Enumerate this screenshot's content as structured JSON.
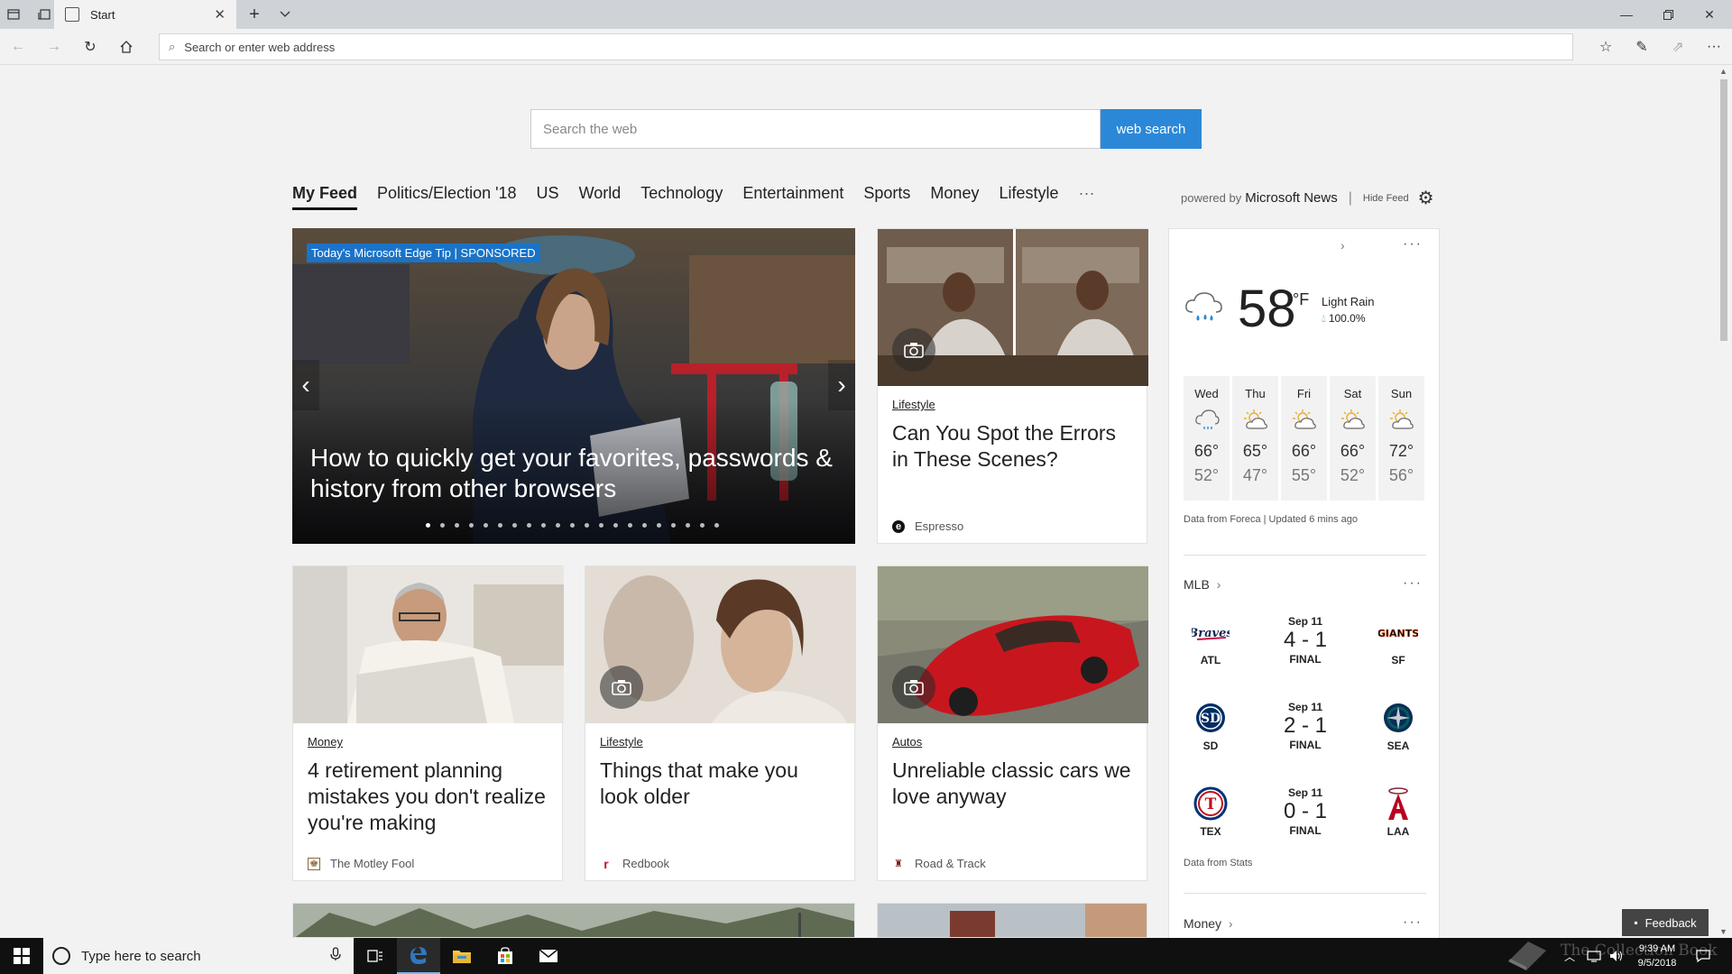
{
  "browser": {
    "tab_title": "Start",
    "address_placeholder": "Search or enter web address"
  },
  "search": {
    "placeholder": "Search the web",
    "button_label": "web search"
  },
  "feed_nav": {
    "items": [
      "My Feed",
      "Politics/Election '18",
      "US",
      "World",
      "Technology",
      "Entertainment",
      "Sports",
      "Money",
      "Lifestyle",
      "···"
    ],
    "powered_prefix": "powered by",
    "powered_brand": "Microsoft News",
    "hide_feed": "Hide Feed"
  },
  "hero": {
    "badge": "Today's Microsoft Edge Tip | SPONSORED",
    "title": "How to quickly get your favorites, passwords & history from other browsers",
    "slide_count": 21,
    "active_slide": 1
  },
  "cards": [
    {
      "category": "Lifestyle",
      "headline": "Can You Spot the Errors in These Scenes?",
      "source": "Espresso"
    },
    {
      "category": "Money",
      "headline": "4 retirement planning mistakes you don't realize you're making",
      "source": "The Motley Fool"
    },
    {
      "category": "Lifestyle",
      "headline": "Things that make you look older",
      "source": "Redbook"
    },
    {
      "category": "Autos",
      "headline": "Unreliable classic cars we love anyway",
      "source": "Road & Track"
    }
  ],
  "weather": {
    "temp": "58",
    "unit": "°F",
    "condition": "Light Rain",
    "precip": "100.0%",
    "days": [
      {
        "name": "Wed",
        "hi": "66°",
        "lo": "52°",
        "icon": "rain-cloud"
      },
      {
        "name": "Thu",
        "hi": "65°",
        "lo": "47°",
        "icon": "partly-sunny"
      },
      {
        "name": "Fri",
        "hi": "66°",
        "lo": "55°",
        "icon": "partly-sunny"
      },
      {
        "name": "Sat",
        "hi": "66°",
        "lo": "52°",
        "icon": "partly-sunny"
      },
      {
        "name": "Sun",
        "hi": "72°",
        "lo": "56°",
        "icon": "partly-sunny"
      }
    ],
    "note": "Data from Foreca | Updated 6 mins ago"
  },
  "mlb": {
    "title": "MLB",
    "games": [
      {
        "date": "Sep 11",
        "score": "4 - 1",
        "status": "FINAL",
        "home": "ATL",
        "away": "SF"
      },
      {
        "date": "Sep 11",
        "score": "2 - 1",
        "status": "FINAL",
        "home": "SD",
        "away": "SEA"
      },
      {
        "date": "Sep 11",
        "score": "0 - 1",
        "status": "FINAL",
        "home": "TEX",
        "away": "LAA"
      }
    ],
    "note": "Data from Stats"
  },
  "money": {
    "title": "Money"
  },
  "feedback": "Feedback",
  "taskbar": {
    "search_placeholder": "Type here to search",
    "time": "9:39 AM",
    "date": "9/5/2018"
  },
  "watermark": "The Collection Book",
  "colors": {
    "accent": "#2b88d8",
    "badge": "#1a73c8"
  }
}
